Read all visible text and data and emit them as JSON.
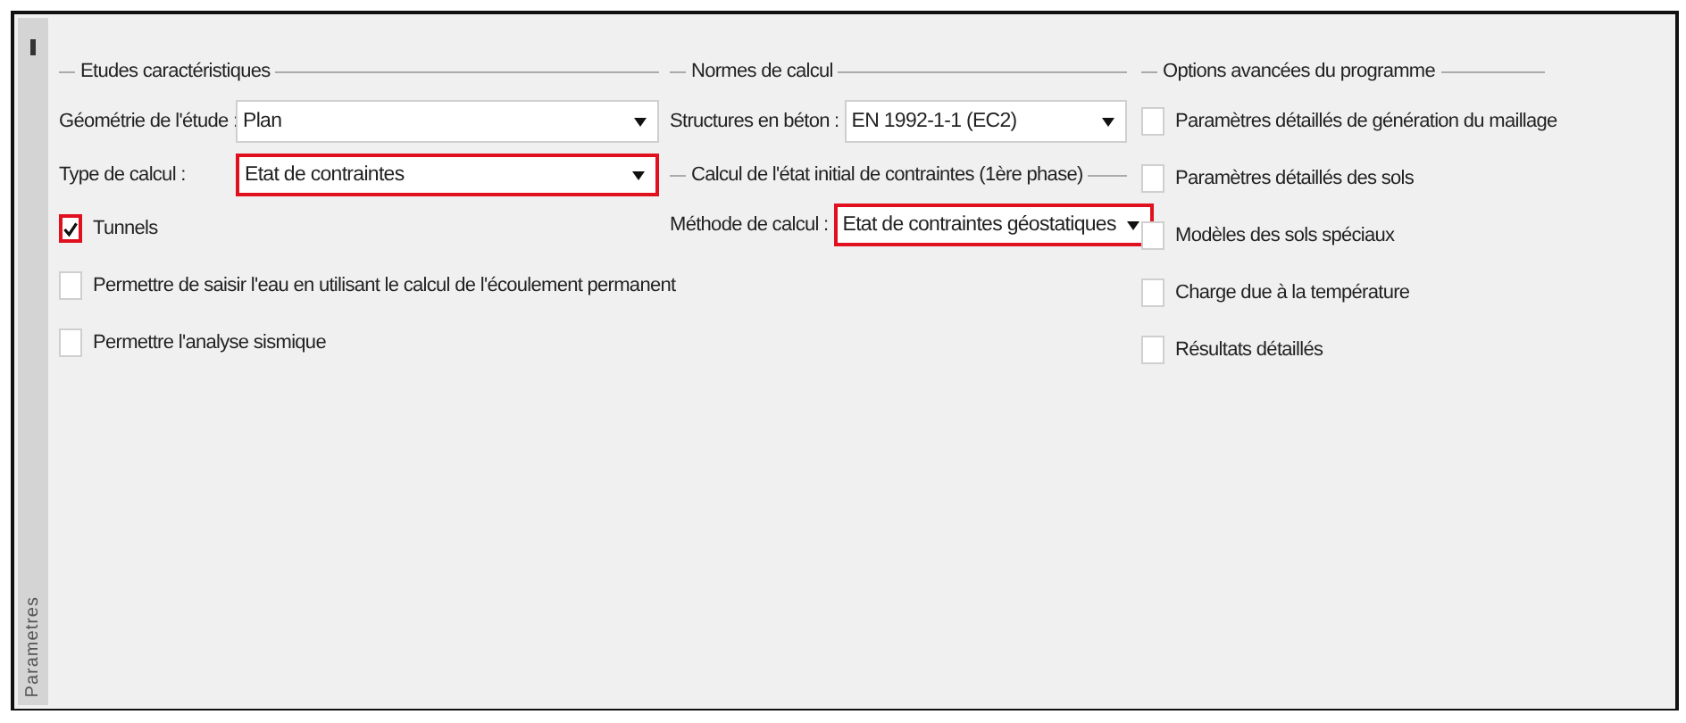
{
  "side_tab": {
    "label": "Parametres"
  },
  "groups": [
    {
      "legend": "Etudes caractéristiques",
      "items": [
        {
          "kind": "select",
          "label": "Géométrie de l'étude :",
          "value": "Plan",
          "highlighted": false
        },
        {
          "kind": "select",
          "label": "Type de calcul :",
          "value": "Etat de contraintes",
          "highlighted": true
        },
        {
          "kind": "checkbox",
          "label": "Tunnels",
          "checked": true,
          "highlighted": true
        },
        {
          "kind": "checkbox",
          "label": "Permettre de saisir l'eau en utilisant le calcul de l'écoulement permanent",
          "checked": false,
          "highlighted": false
        },
        {
          "kind": "checkbox",
          "label": "Permettre l'analyse sismique",
          "checked": false,
          "highlighted": false
        }
      ]
    },
    {
      "legend": "Normes de calcul",
      "items": [
        {
          "kind": "select",
          "label": "Structures en béton :",
          "value": "EN 1992-1-1 (EC2)",
          "highlighted": false
        },
        {
          "kind": "legend",
          "label": "Calcul de l'état initial de contraintes (1ère phase)"
        },
        {
          "kind": "select",
          "label": "Méthode de calcul :",
          "value": "Etat de contraintes géostatiques",
          "highlighted": true
        }
      ]
    },
    {
      "legend": "Options avancées du programme",
      "items": [
        {
          "kind": "checkbox",
          "label": "Paramètres détaillés de génération du maillage",
          "checked": false,
          "highlighted": false
        },
        {
          "kind": "checkbox",
          "label": "Paramètres détaillés des sols",
          "checked": false,
          "highlighted": false
        },
        {
          "kind": "checkbox",
          "label": "Modèles des sols spéciaux",
          "checked": false,
          "highlighted": false
        },
        {
          "kind": "checkbox",
          "label": "Charge due à la température",
          "checked": false,
          "highlighted": false
        },
        {
          "kind": "checkbox",
          "label": "Résultats détaillés",
          "checked": false,
          "highlighted": false
        }
      ]
    }
  ]
}
